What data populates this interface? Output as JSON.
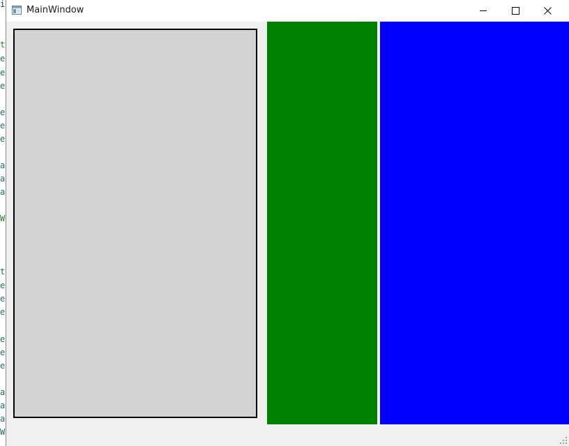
{
  "window": {
    "title": "MainWindow",
    "icon": "app-window-icon",
    "controls": {
      "minimize_icon": "minimize-icon",
      "maximize_icon": "maximize-icon",
      "close_icon": "close-icon"
    }
  },
  "background_editor": {
    "line_chars": [
      {
        "text": "i",
        "color": "#1f3d7a"
      },
      {
        "text": "t",
        "color": "#2a7a2a"
      },
      {
        "text": "e",
        "color": "#1a6a6a"
      },
      {
        "text": "e",
        "color": "#1a6a6a"
      },
      {
        "text": "e",
        "color": "#1a6a6a"
      },
      {
        "text": "e",
        "color": "#1a6a6a"
      },
      {
        "text": "e",
        "color": "#1a6a6a"
      },
      {
        "text": "e",
        "color": "#1a6a6a"
      },
      {
        "text": "a",
        "color": "#1a6a6a"
      },
      {
        "text": "a",
        "color": "#1a6a6a"
      },
      {
        "text": "a",
        "color": "#1a6a6a"
      },
      {
        "text": "W",
        "color": "#2a7a2a"
      },
      {
        "text": "t",
        "color": "#1a6a6a"
      },
      {
        "text": "e",
        "color": "#1a6a6a"
      },
      {
        "text": "e",
        "color": "#1a6a6a"
      },
      {
        "text": "e",
        "color": "#1a6a6a"
      },
      {
        "text": "e",
        "color": "#1a6a6a"
      },
      {
        "text": "e",
        "color": "#1a6a6a"
      },
      {
        "text": "e",
        "color": "#1a6a6a"
      },
      {
        "text": "a",
        "color": "#1a6a6a"
      },
      {
        "text": "a",
        "color": "#1a6a6a"
      },
      {
        "text": "a",
        "color": "#1a6a6a"
      },
      {
        "text": "W",
        "color": "#1a6a6a"
      }
    ]
  },
  "panels": {
    "gray": {
      "color": "#d3d3d3",
      "border": "#000000"
    },
    "green": {
      "color": "#008000"
    },
    "blue": {
      "color": "#0000ff"
    }
  }
}
